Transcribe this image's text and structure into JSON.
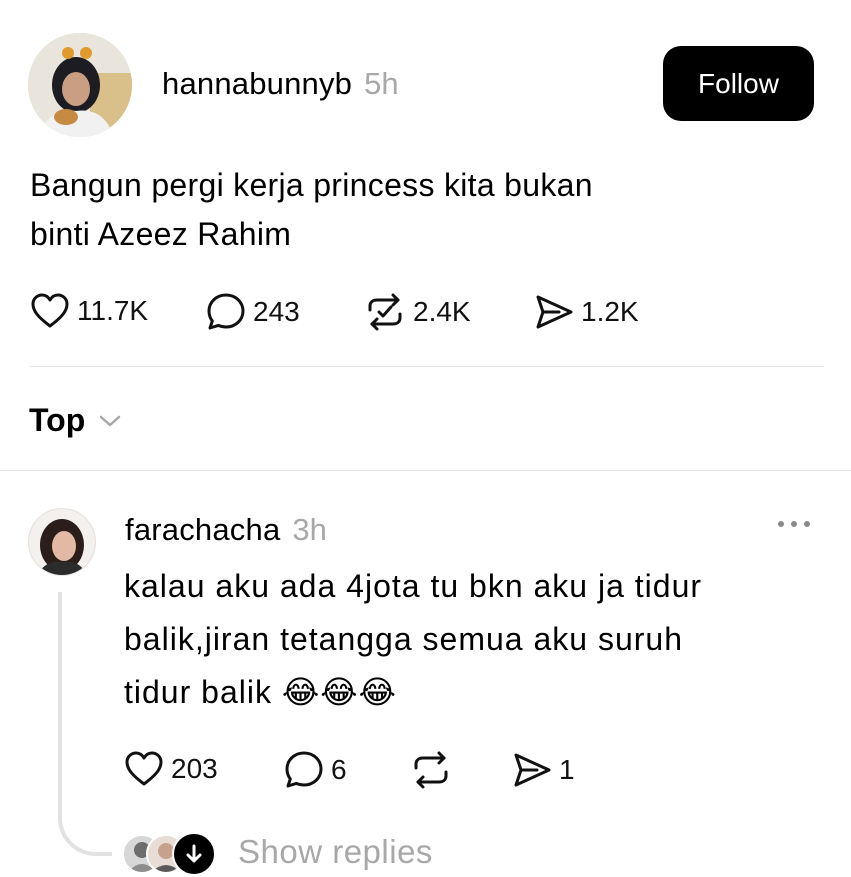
{
  "post": {
    "username": "hannabunnyb",
    "time": "5h",
    "follow_label": "Follow",
    "text_line1": "Bangun pergi kerja princess kita bukan",
    "text_line2": "binti Azeez Rahim",
    "likes": "11.7K",
    "comments": "243",
    "reposts": "2.4K",
    "shares": "1.2K"
  },
  "sort": {
    "label": "Top"
  },
  "comment": {
    "username": "farachacha",
    "time": "3h",
    "text_line1": "kalau aku ada 4jota tu bkn aku ja tidur",
    "text_line2": "balik,jiran tetangga semua aku suruh",
    "text_line3": "tidur balik",
    "emoji": "😂😂😂",
    "likes": "203",
    "comments": "6",
    "shares": "1",
    "show_replies": "Show replies"
  },
  "icons": {
    "like": "heart-icon",
    "comment": "speech-bubble-icon",
    "repost": "repost-icon",
    "share": "send-icon",
    "more": "more-dots-icon",
    "sort": "chevron-down-icon"
  },
  "colors": {
    "follow_bg": "#000000",
    "muted_text": "#a8a8a8",
    "divider": "#e6e6e6"
  }
}
